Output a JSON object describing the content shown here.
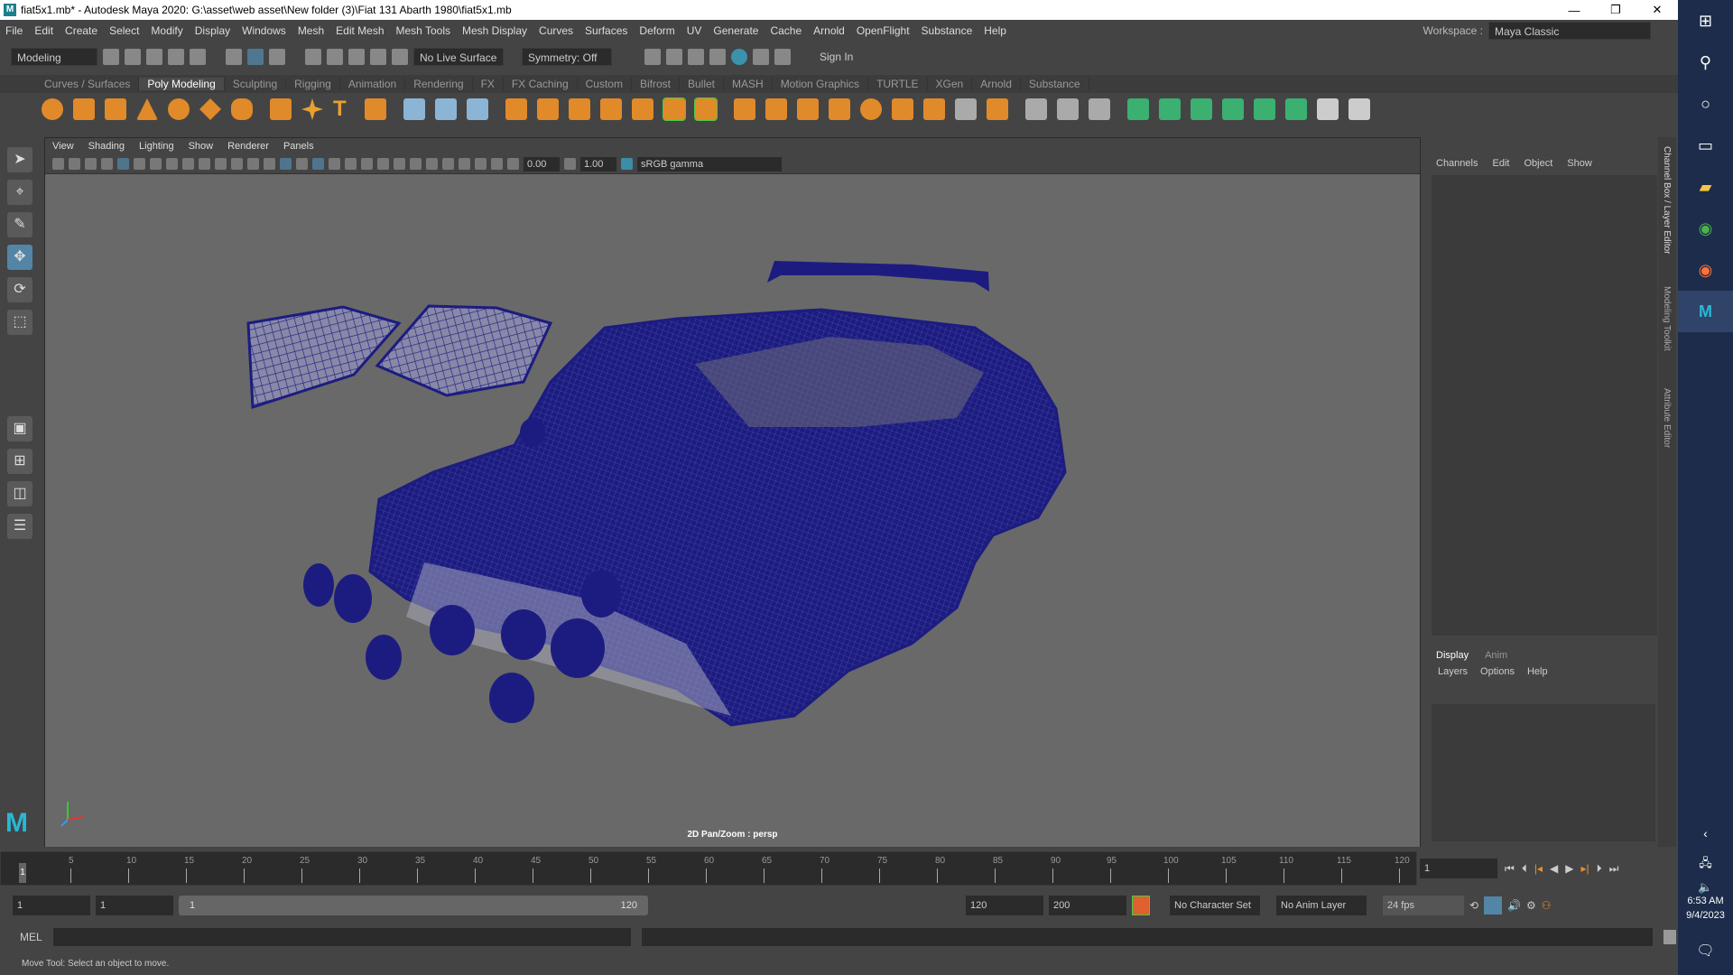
{
  "title": "fiat5x1.mb* - Autodesk Maya 2020: G:\\asset\\web asset\\New folder (3)\\Fiat 131 Abarth 1980\\fiat5x1.mb",
  "window_controls": {
    "minimize": "—",
    "maximize": "❐",
    "close": "✕"
  },
  "menu": [
    "File",
    "Edit",
    "Create",
    "Select",
    "Modify",
    "Display",
    "Windows",
    "Mesh",
    "Edit Mesh",
    "Mesh Tools",
    "Mesh Display",
    "Curves",
    "Surfaces",
    "Deform",
    "UV",
    "Generate",
    "Cache",
    "Arnold",
    "OpenFlight",
    "Substance",
    "Help"
  ],
  "workspace": {
    "label": "Workspace :",
    "value": "Maya Classic"
  },
  "statusline": {
    "mode": "Modeling",
    "live_surface": "No Live Surface",
    "symmetry": "Symmetry: Off",
    "sign_in": "Sign In"
  },
  "shelf_tabs": [
    "Curves / Surfaces",
    "Poly Modeling",
    "Sculpting",
    "Rigging",
    "Animation",
    "Rendering",
    "FX",
    "FX Caching",
    "Custom",
    "Bifrost",
    "Bullet",
    "MASH",
    "Motion Graphics",
    "TURTLE",
    "XGen",
    "Arnold",
    "Substance"
  ],
  "active_shelf": "Poly Modeling",
  "panel_menu": [
    "View",
    "Shading",
    "Lighting",
    "Show",
    "Renderer",
    "Panels"
  ],
  "panel_bar": {
    "exposure": "0.00",
    "gamma": "1.00",
    "color_space": "sRGB gamma"
  },
  "camera_label": "2D Pan/Zoom : persp",
  "channel_box": {
    "tabs": [
      "Channels",
      "Edit",
      "Object",
      "Show"
    ]
  },
  "layer_editor": {
    "tabs": [
      "Display",
      "Anim"
    ],
    "menu": [
      "Layers",
      "Options",
      "Help"
    ]
  },
  "side_tabs": [
    "Channel Box / Layer Editor",
    "Modeling Toolkit",
    "Attribute Editor"
  ],
  "timeslider": {
    "ticks": [
      "5",
      "10",
      "15",
      "20",
      "25",
      "30",
      "35",
      "40",
      "45",
      "50",
      "55",
      "60",
      "65",
      "70",
      "75",
      "80",
      "85",
      "90",
      "95",
      "100",
      "105",
      "110",
      "115",
      "120"
    ],
    "current": "1",
    "current_frame": "1"
  },
  "range": {
    "start": "1",
    "playback_start": "1",
    "slider_start": "1",
    "slider_end": "120",
    "playback_end": "120",
    "end": "200",
    "character_set": "No Character Set",
    "anim_layer": "No Anim Layer",
    "fps": "24 fps"
  },
  "mel": {
    "label": "MEL"
  },
  "help_line": "Move Tool: Select an object to move.",
  "clock": {
    "time": "6:53 AM",
    "date": "9/4/2023"
  },
  "colors": {
    "wire": "#1c1c80",
    "viewport": "#696969",
    "accent": "#5285a6"
  }
}
